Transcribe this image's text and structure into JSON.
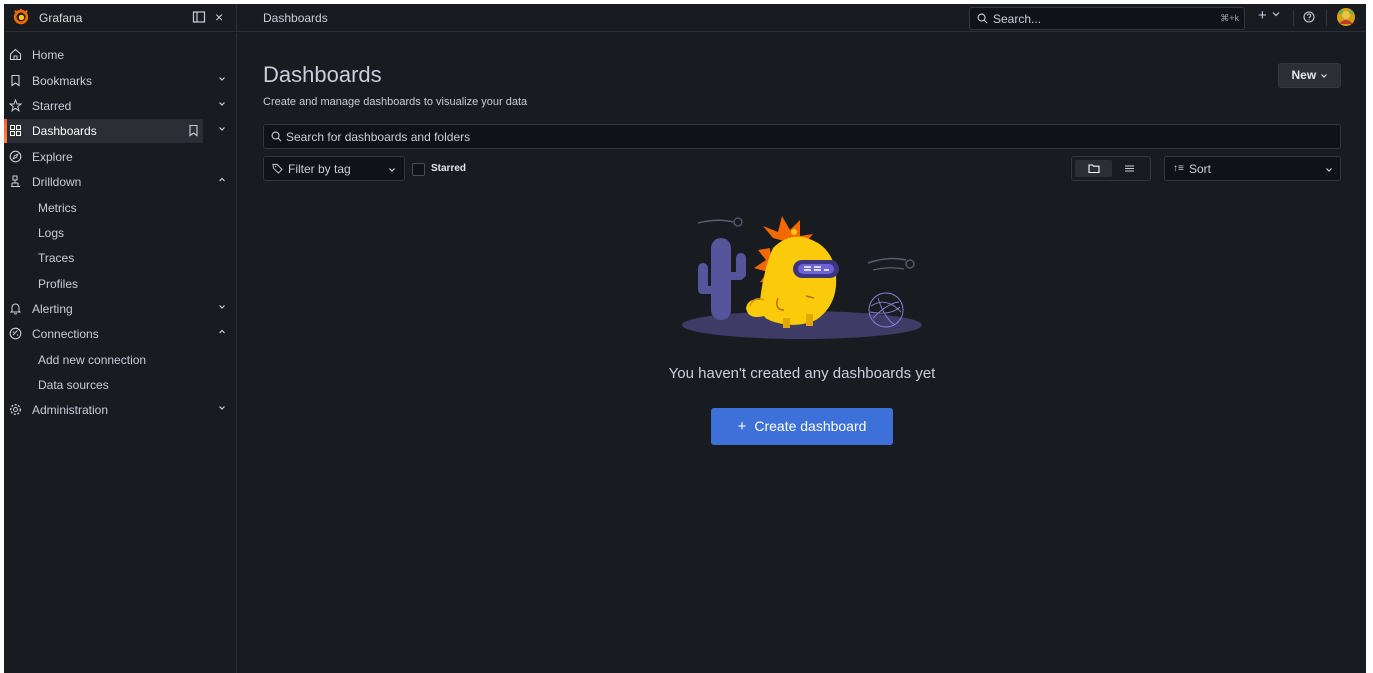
{
  "app": {
    "name": "Grafana",
    "breadcrumb": "Dashboards"
  },
  "topbar": {
    "search_placeholder": "Search...",
    "search_shortcut": "⌘+k",
    "plus_label": "+",
    "close_label": "×"
  },
  "sidebar": {
    "items": [
      {
        "label": "Home",
        "icon": "home-icon"
      },
      {
        "label": "Bookmarks",
        "icon": "bookmark-icon"
      },
      {
        "label": "Starred",
        "icon": "star-icon"
      },
      {
        "label": "Dashboards",
        "icon": "apps-icon"
      },
      {
        "label": "Explore",
        "icon": "compass-icon"
      },
      {
        "label": "Drilldown",
        "icon": "drilldown-icon"
      },
      {
        "label": "Metrics"
      },
      {
        "label": "Logs"
      },
      {
        "label": "Traces"
      },
      {
        "label": "Profiles"
      },
      {
        "label": "Alerting",
        "icon": "bell-icon"
      },
      {
        "label": "Connections",
        "icon": "link-icon"
      },
      {
        "label": "Add new connection"
      },
      {
        "label": "Data sources"
      },
      {
        "label": "Administration",
        "icon": "cog-icon"
      }
    ]
  },
  "main": {
    "title": "Dashboards",
    "subtitle": "Create and manage dashboards to visualize your data",
    "new_button": "New",
    "search_placeholder": "Search for dashboards and folders",
    "tag_filter_placeholder": "Filter by tag",
    "starred_label": "Starred",
    "sort_placeholder": "Sort",
    "sort_icon": "↑≡",
    "empty_message": "You haven't created any dashboards yet",
    "create_button": "Create dashboard",
    "create_plus": "+"
  },
  "colors": {
    "background": "#181b1f",
    "accent_blue": "#3d71d9",
    "active_bar": "#f55f3e"
  }
}
